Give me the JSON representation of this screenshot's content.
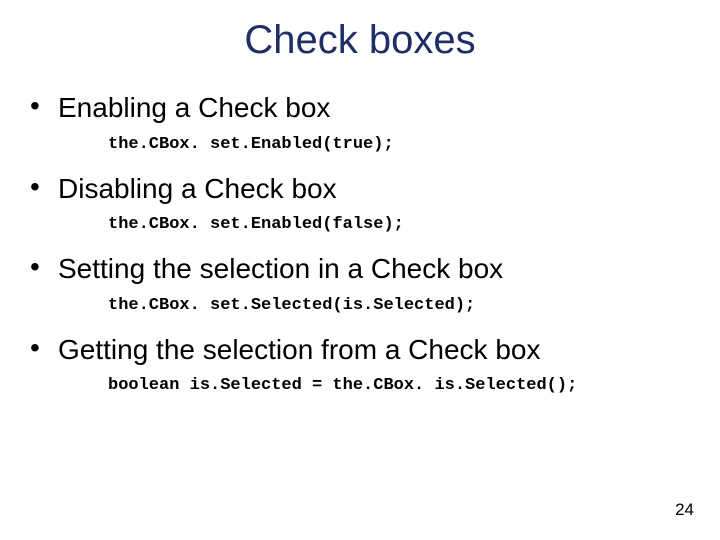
{
  "title": "Check boxes",
  "items": [
    {
      "heading": "Enabling a Check box",
      "code": "the.CBox. set.Enabled(true);"
    },
    {
      "heading": "Disabling a Check box",
      "code": "the.CBox. set.Enabled(false);"
    },
    {
      "heading": "Setting the selection in a Check box",
      "code": "the.CBox. set.Selected(is.Selected);"
    },
    {
      "heading": "Getting the selection from a Check box",
      "code": "boolean is.Selected = the.CBox. is.Selected();"
    }
  ],
  "page_number": "24"
}
